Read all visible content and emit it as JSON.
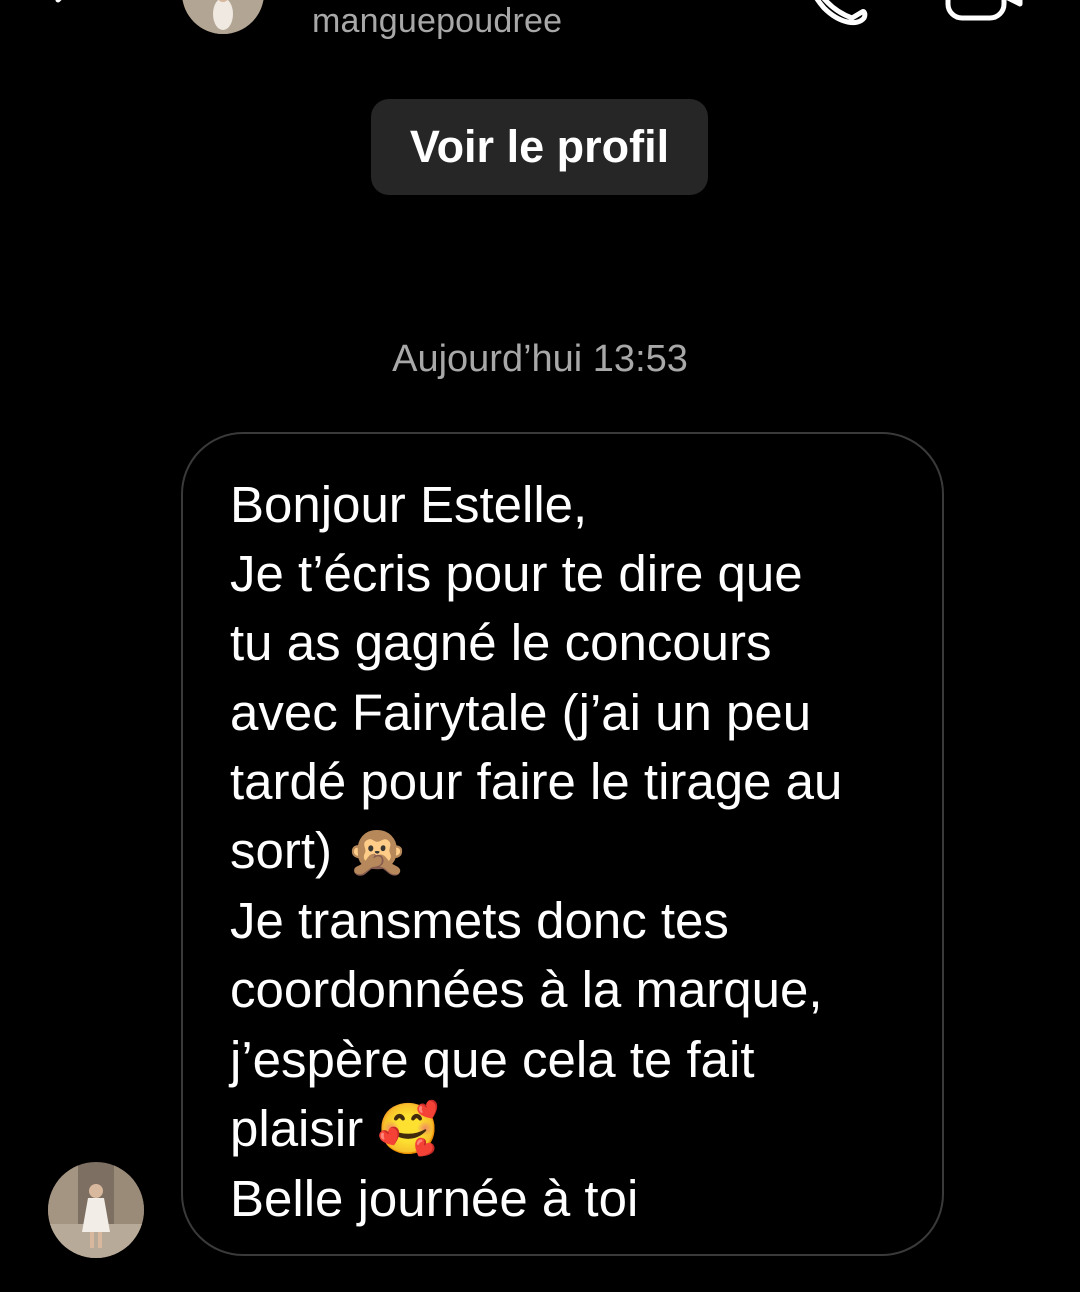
{
  "header": {
    "username": "manguepoudree",
    "back_icon": "chevron-left-icon",
    "call_icon": "phone-icon",
    "video_icon": "video-camera-icon"
  },
  "profile_button": {
    "label": "Voir le profil"
  },
  "conversation": {
    "timestamp": "Aujourd’hui 13:53",
    "message": {
      "lines": [
        "Bonjour Estelle,",
        "Je t’écris pour te dire que",
        "tu as gagné le concours",
        "avec Fairytale (j’ai un peu",
        "tardé pour faire le tirage au",
        "sort)",
        "Je transmets donc tes",
        "coordonnées à la marque,",
        "j’espère que cela te fait",
        "plaisir",
        "Belle journée à toi"
      ],
      "emoji_1": "🙊",
      "emoji_2": "🥰"
    }
  },
  "colors": {
    "background": "#000000",
    "button_bg": "#262626",
    "secondary_text": "#a8a8a8",
    "bubble_border": "#3a3a3a",
    "text": "#ffffff"
  }
}
